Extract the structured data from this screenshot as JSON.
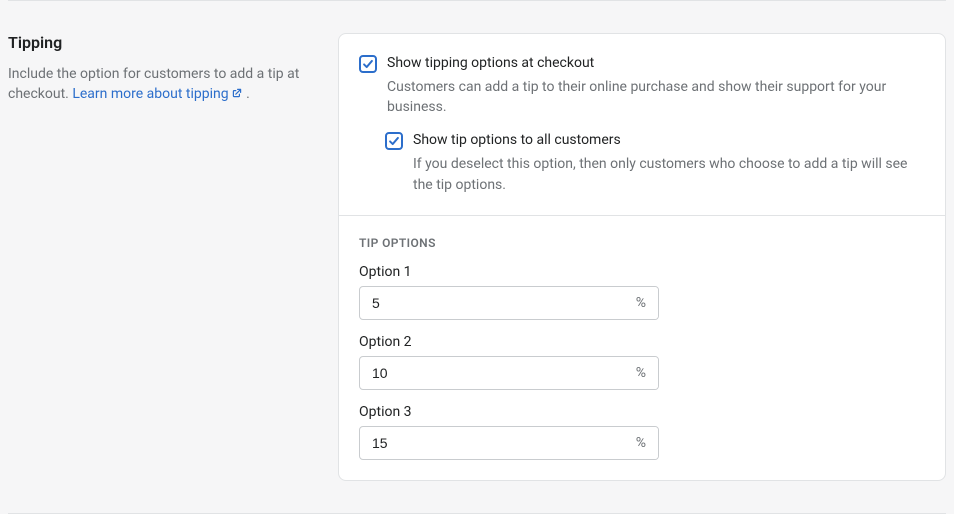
{
  "section": {
    "title": "Tipping",
    "description_prefix": "Include the option for customers to add a tip at checkout. ",
    "link_text": "Learn more about tipping",
    "description_suffix": " ."
  },
  "checkboxes": {
    "show_tipping": {
      "label": "Show tipping options at checkout",
      "help": "Customers can add a tip to their online purchase and show their support for your business."
    },
    "show_all": {
      "label": "Show tip options to all customers",
      "help": "If you deselect this option, then only customers who choose to add a tip will see the tip options."
    }
  },
  "tip_options": {
    "heading": "TIP OPTIONS",
    "suffix": "%",
    "items": [
      {
        "label": "Option 1",
        "value": "5"
      },
      {
        "label": "Option 2",
        "value": "10"
      },
      {
        "label": "Option 3",
        "value": "15"
      }
    ]
  }
}
